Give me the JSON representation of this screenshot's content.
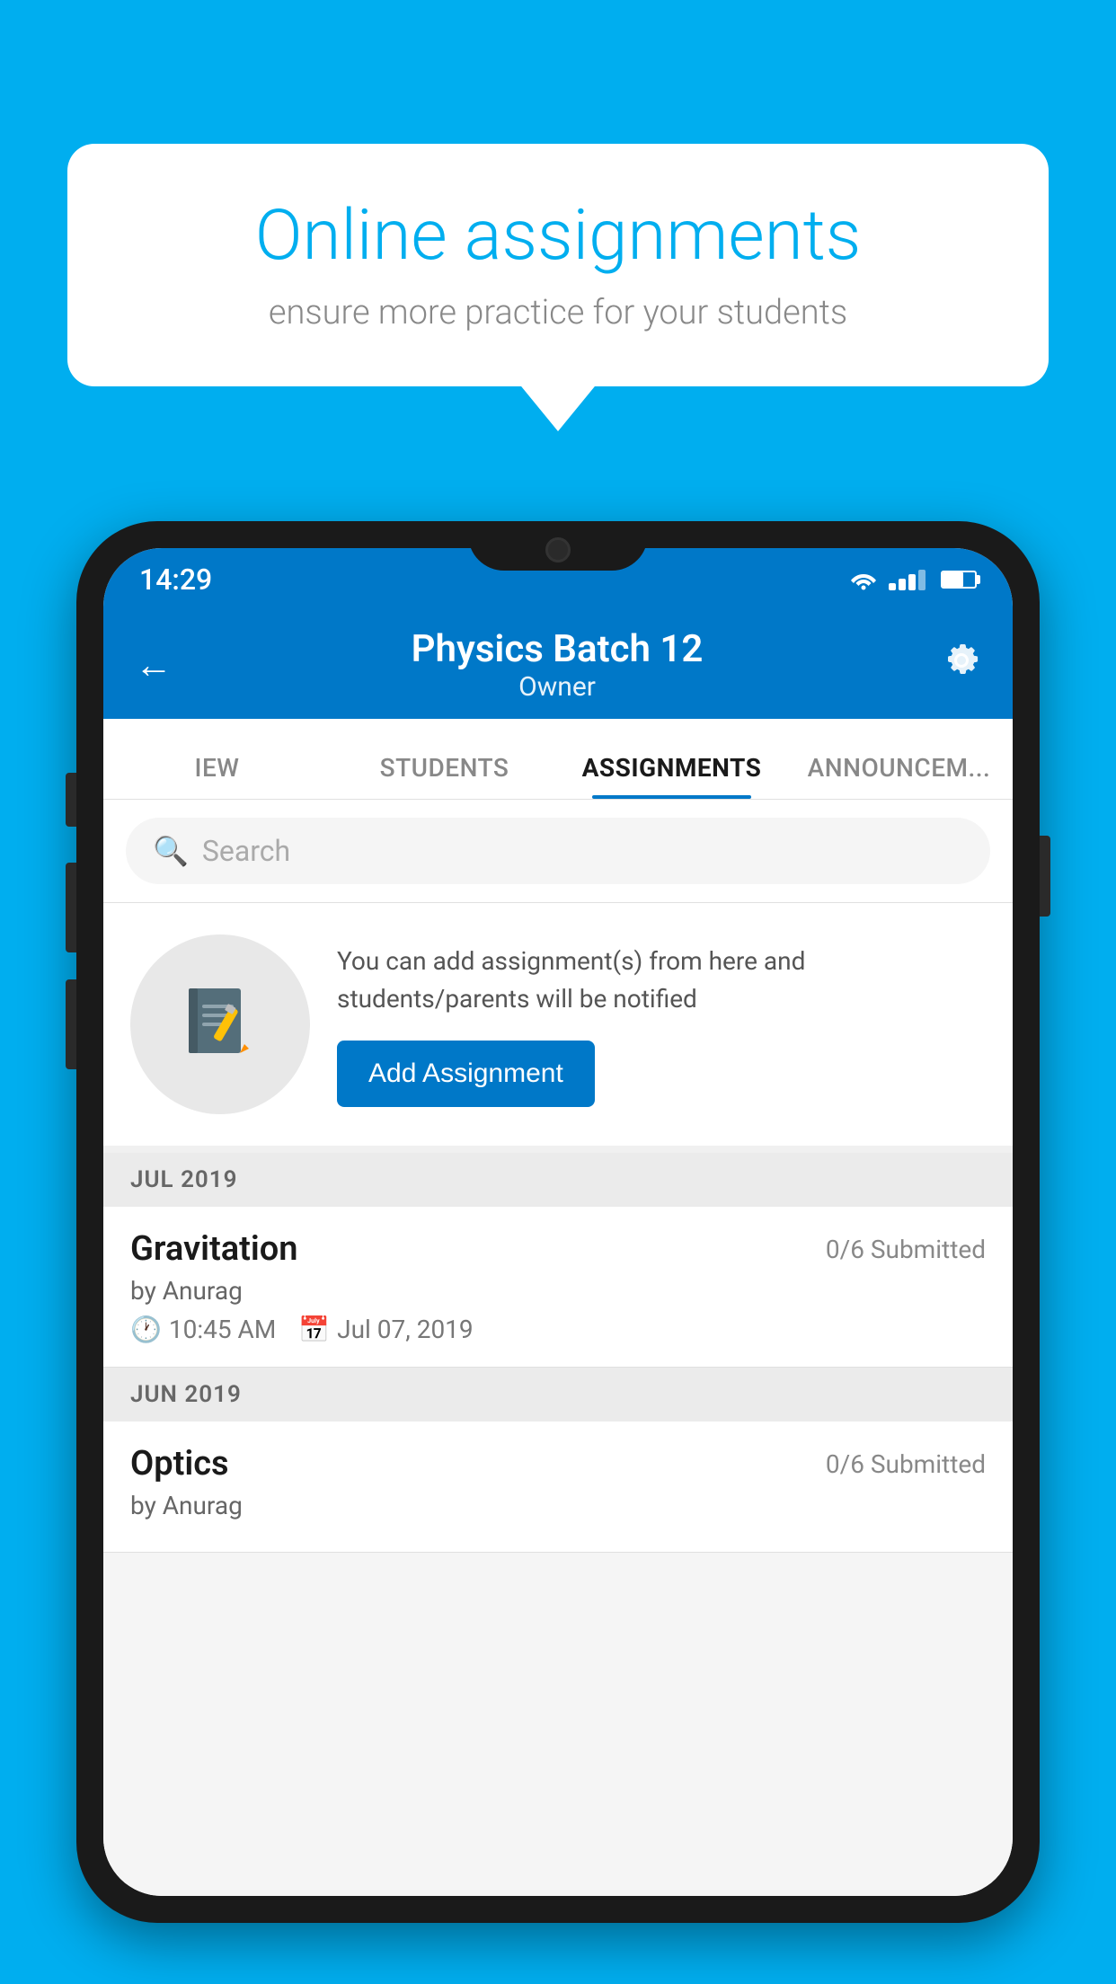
{
  "background": {
    "color": "#00AEEF"
  },
  "speech_bubble": {
    "title": "Online assignments",
    "subtitle": "ensure more practice for your students"
  },
  "phone": {
    "status_bar": {
      "time": "14:29"
    },
    "header": {
      "title": "Physics Batch 12",
      "subtitle": "Owner",
      "back_label": "←",
      "settings_label": "⚙"
    },
    "tabs": [
      {
        "label": "IEW",
        "active": false
      },
      {
        "label": "STUDENTS",
        "active": false
      },
      {
        "label": "ASSIGNMENTS",
        "active": true
      },
      {
        "label": "ANNOUNCEM...",
        "active": false
      }
    ],
    "search": {
      "placeholder": "Search"
    },
    "add_assignment": {
      "description": "You can add assignment(s) from here and students/parents will be notified",
      "button_label": "Add Assignment"
    },
    "sections": [
      {
        "label": "JUL 2019",
        "assignments": [
          {
            "name": "Gravitation",
            "submitted": "0/6 Submitted",
            "by": "by Anurag",
            "time": "10:45 AM",
            "date": "Jul 07, 2019"
          }
        ]
      },
      {
        "label": "JUN 2019",
        "assignments": [
          {
            "name": "Optics",
            "submitted": "0/6 Submitted",
            "by": "by Anurag",
            "time": "",
            "date": ""
          }
        ]
      }
    ]
  }
}
